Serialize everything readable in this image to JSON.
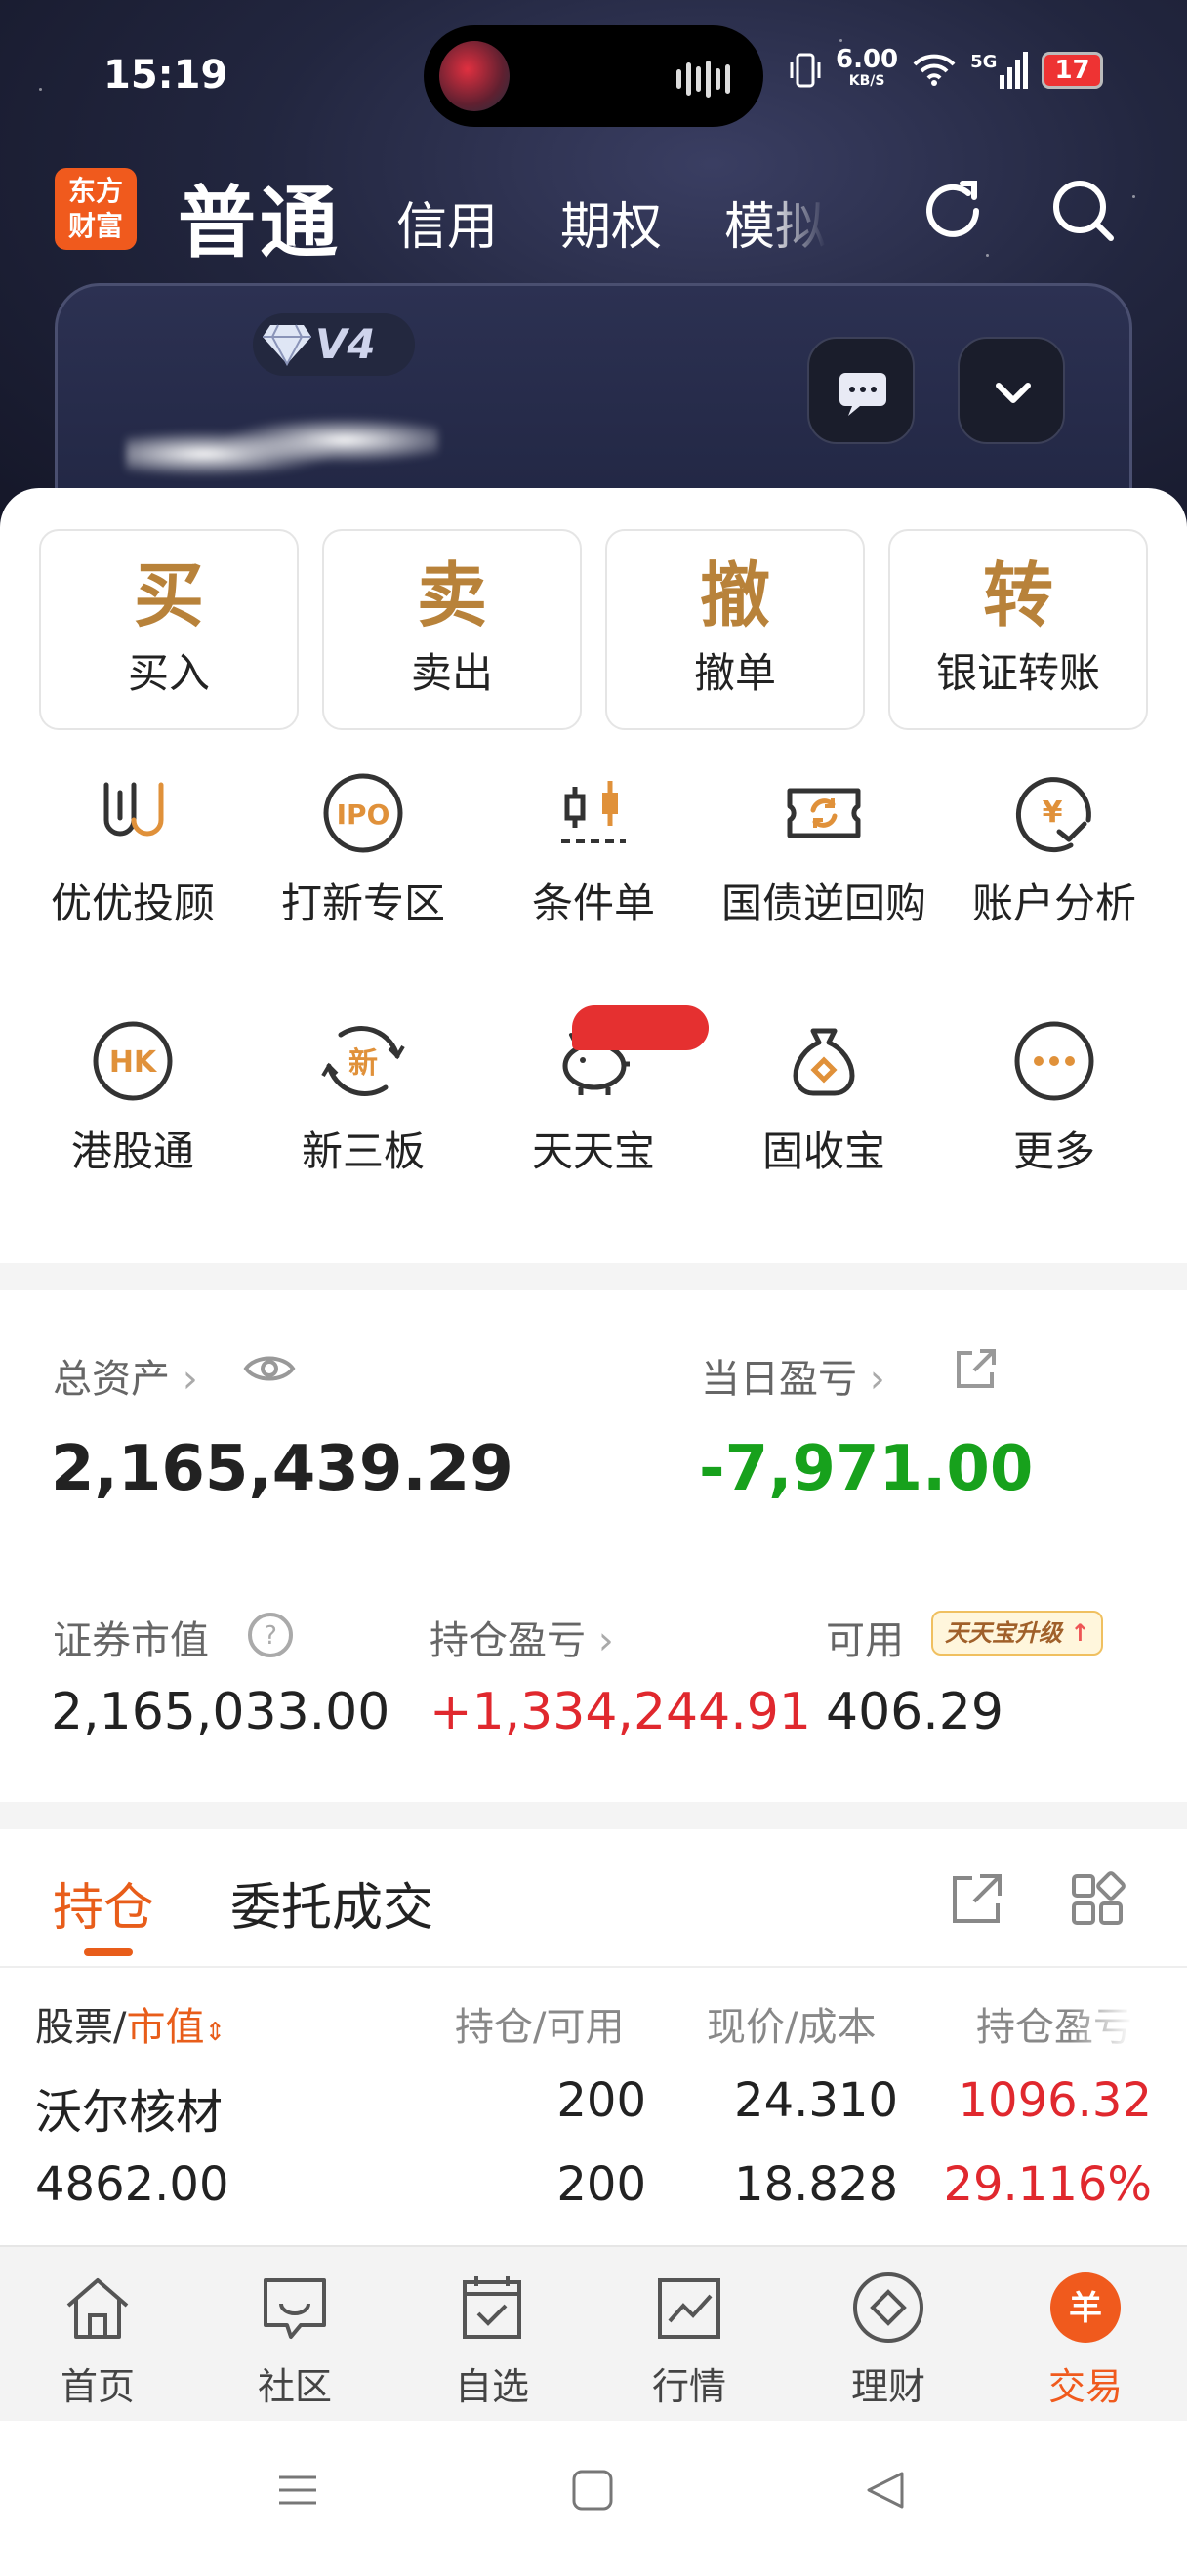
{
  "status_bar": {
    "time": "15:19",
    "net_speed": "6.00",
    "net_unit": "KB/S",
    "net_type": "5G",
    "battery": "17"
  },
  "header": {
    "logo": "东方财富",
    "tabs": [
      "普通",
      "信用",
      "期权",
      "模拟"
    ]
  },
  "account": {
    "level": "V4"
  },
  "quick_actions": [
    {
      "glyph": "买",
      "label": "买入"
    },
    {
      "glyph": "卖",
      "label": "卖出"
    },
    {
      "glyph": "撤",
      "label": "撤单"
    },
    {
      "glyph": "转",
      "label": "银证转账"
    }
  ],
  "services": [
    {
      "label": "优优投顾",
      "icon": "uu-icon"
    },
    {
      "label": "打新专区",
      "icon": "ipo-icon",
      "icon_text": "IPO"
    },
    {
      "label": "条件单",
      "icon": "candlestick-icon"
    },
    {
      "label": "国债逆回购",
      "icon": "ticket-icon"
    },
    {
      "label": "账户分析",
      "icon": "yuan-chart-icon",
      "icon_text": "¥"
    },
    {
      "label": "港股通",
      "icon": "hk-icon",
      "icon_text": "HK"
    },
    {
      "label": "新三板",
      "icon": "new-board-icon",
      "icon_text": "新"
    },
    {
      "label": "天天宝",
      "icon": "piggy-bank-icon"
    },
    {
      "label": "固收宝",
      "icon": "money-bag-icon"
    },
    {
      "label": "更多",
      "icon": "more-icon"
    }
  ],
  "assets": {
    "total_label": "总资产",
    "total_value": "2,165,439.29",
    "daily_pl_label": "当日盈亏",
    "daily_pl_value": "-7,971.00",
    "market_value_label": "证券市值",
    "market_value": "2,165,033.00",
    "holding_pl_label": "持仓盈亏",
    "holding_pl_value": "+1,334,244.91",
    "available_label": "可用",
    "available_badge": "天天宝升级",
    "available_value": "406.29"
  },
  "holdings": {
    "tabs": [
      "持仓",
      "委托成交"
    ],
    "headers": {
      "stock": "股票/",
      "sort": "市值",
      "qty": "持仓/可用",
      "price": "现价/成本",
      "pl": "持仓盈亏"
    },
    "rows": [
      {
        "name": "沃尔核材",
        "market_value": "4862.00",
        "qty": "200",
        "avail": "200",
        "price": "24.310",
        "cost": "18.828",
        "pl": "1096.32",
        "pl_pct": "29.116%"
      }
    ]
  },
  "bottom_nav": [
    {
      "label": "首页",
      "icon": "home-icon"
    },
    {
      "label": "社区",
      "icon": "chat-icon"
    },
    {
      "label": "自选",
      "icon": "checkbox-icon"
    },
    {
      "label": "行情",
      "icon": "line-chart-icon"
    },
    {
      "label": "理财",
      "icon": "diamond-icon"
    },
    {
      "label": "交易",
      "icon": "yuan-circle-icon",
      "icon_text": "羊"
    }
  ],
  "colors": {
    "accent": "#f05a1d",
    "gold": "#b8823a",
    "gain": "#e0282e",
    "loss": "#17a11c"
  }
}
